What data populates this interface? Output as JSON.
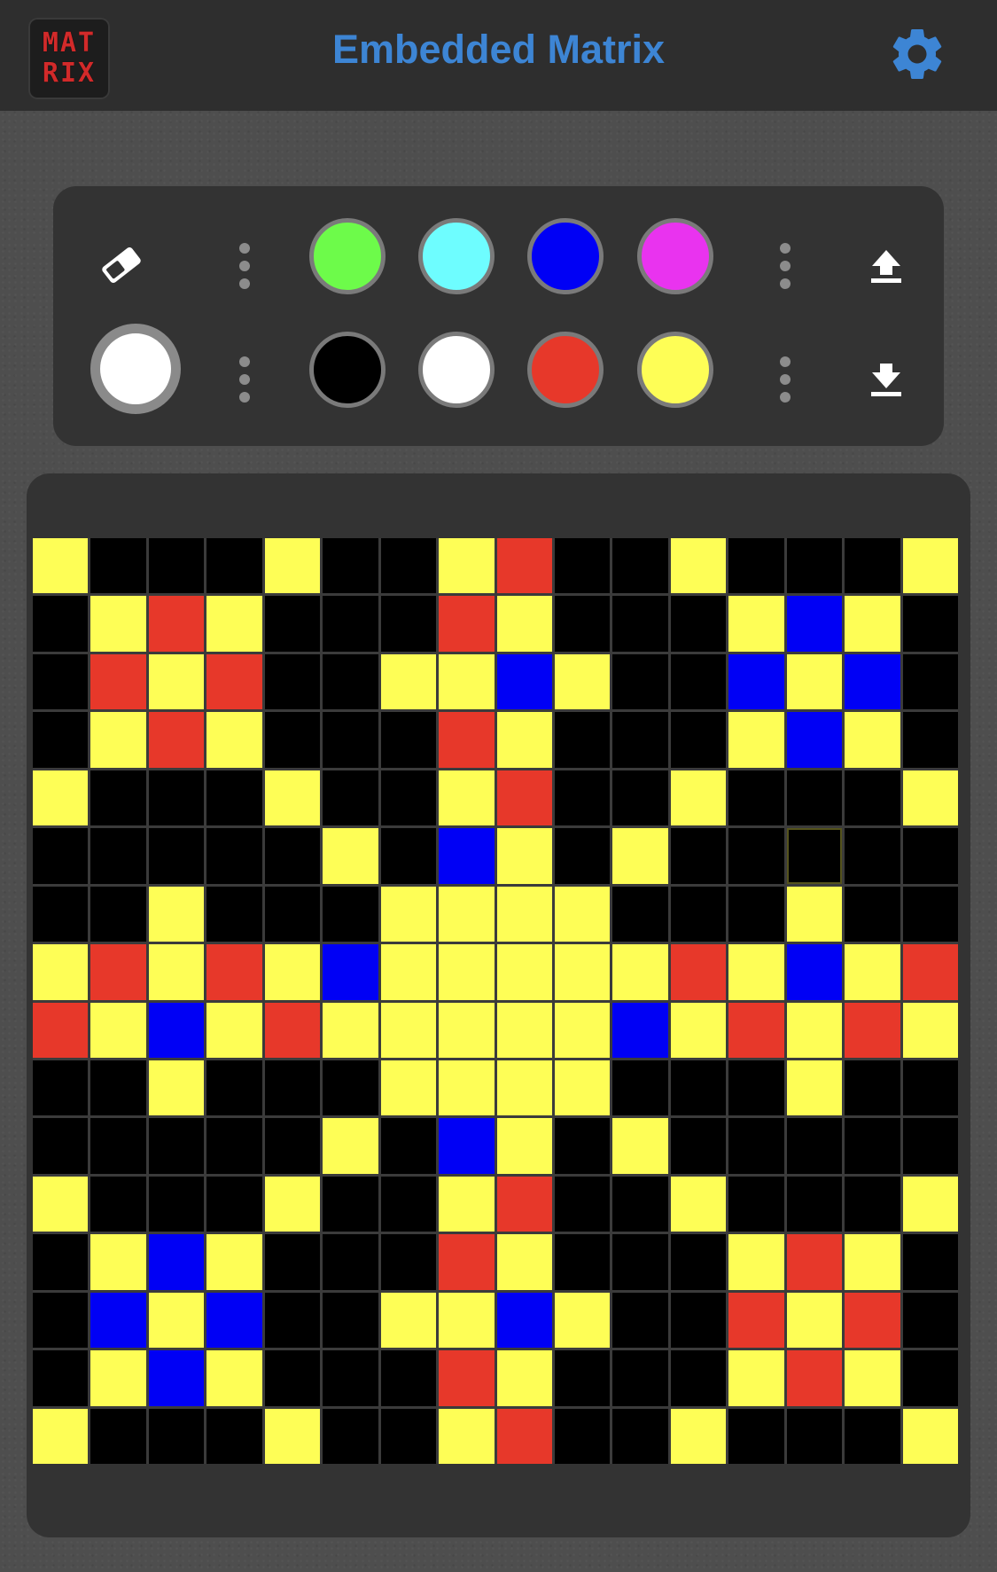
{
  "app": {
    "title": "Embedded Matrix",
    "logo_lines": [
      "MAT",
      "RIX"
    ]
  },
  "toolbar": {
    "eraser_icon": "eraser-icon",
    "upload_icon": "upload-icon",
    "download_icon": "download-icon",
    "settings_icon": "gear-icon",
    "current_color": "#ffffff",
    "palette_top": [
      "#6dfb4a",
      "#6efdff",
      "#0000f5",
      "#e933ef"
    ],
    "palette_bottom": [
      "#000000",
      "#ffffff",
      "#e7382a",
      "#fefe56"
    ]
  },
  "matrix": {
    "size": 16,
    "legend": {
      "K": "#000000",
      "Y": "#fefe56",
      "R": "#e7382a",
      "B": "#0000f5"
    },
    "rows": [
      "YKKKYKKYRKKYKKKY",
      "KYRYKKKRYKKKYBYK",
      "KRYRKKYYBYKKBYBK",
      "KYRYKKKRYKKKYBYK",
      "YKKKYKKYRKKYKKKY",
      "KKKKKYKBYKYKKKKK",
      "KKYKKKYYYYKKKYKK",
      "YRYRYBYYYYYRYBYR",
      "RYBYRYYYYYBYRYRY",
      "KKYKKKYYYYKKKYKK",
      "KKKKKYKBYKYKKKKK",
      "YKKKYKKYRKKYKKKY",
      "KYBYKKKRYKKKYRYK",
      "KBYBKKYYBYKKRYRK",
      "KYBYKKKRYKKKYRYK",
      "YKKKYKKYRKKYKKKY"
    ],
    "selected_cell": [
      5,
      13
    ]
  }
}
